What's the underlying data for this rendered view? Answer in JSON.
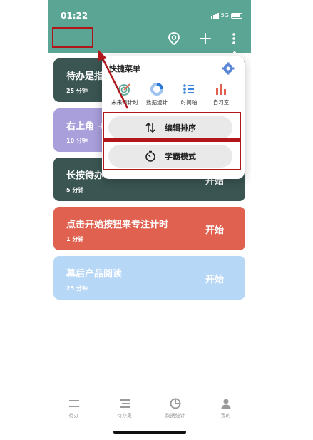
{
  "status_bar": {
    "time": "01:22",
    "network": "5G"
  },
  "cards": [
    {
      "title": "待办是指",
      "duration": "25 分钟",
      "action": ""
    },
    {
      "title": "右上角 +",
      "duration": "10 分钟",
      "action": ""
    },
    {
      "title": "长按待办",
      "duration": "5 分钟",
      "action": "开始"
    },
    {
      "title": "点击开始按钮来专注计时",
      "duration": "1 分钟",
      "action": "开始"
    },
    {
      "title": "幕后产品阅读",
      "duration": "25 分钟",
      "action": "开始"
    }
  ],
  "popup": {
    "title": "快捷菜单",
    "quick_items": [
      {
        "label": "未来倒计时",
        "icon": "target-icon"
      },
      {
        "label": "数据统计",
        "icon": "donut-chart-icon"
      },
      {
        "label": "时间轴",
        "icon": "timeline-icon"
      },
      {
        "label": "自习室",
        "icon": "bar-chart-icon"
      }
    ],
    "actions": [
      {
        "label": "编辑排序",
        "icon": "sort-arrows-icon"
      },
      {
        "label": "学霸模式",
        "icon": "timer-icon"
      }
    ]
  },
  "tabbar": [
    {
      "label": "待办",
      "icon": "todo-icon"
    },
    {
      "label": "待办集",
      "icon": "todo-set-icon"
    },
    {
      "label": "数据统计",
      "icon": "stats-icon"
    },
    {
      "label": "我的",
      "icon": "profile-icon"
    }
  ],
  "colors": {
    "header": "#5aa594",
    "card_dark": "#3a5552",
    "card_purple": "#a99fdb",
    "card_red": "#e0614f",
    "card_blue": "#b7d7f7",
    "annotation": "#b1161b"
  }
}
